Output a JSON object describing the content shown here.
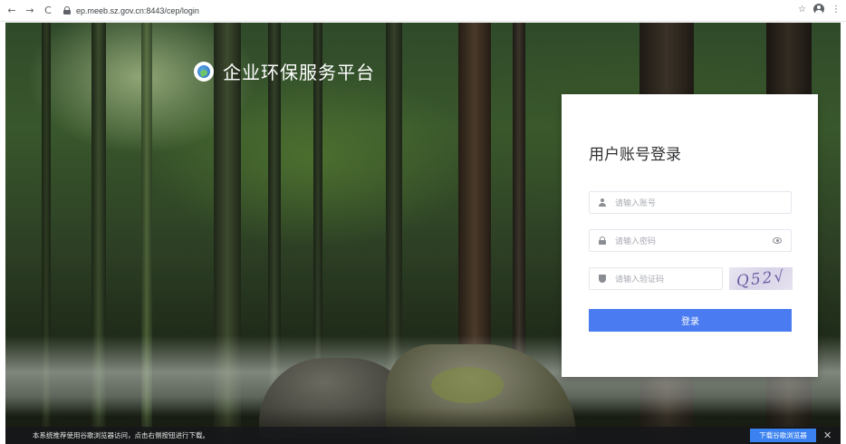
{
  "browser": {
    "back_glyph": "←",
    "forward_glyph": "→",
    "reload_glyph": "C",
    "url": "ep.meeb.sz.gov.cn:8443/cep/login",
    "icons": [
      "back-icon",
      "forward-icon",
      "reload-icon",
      "lock-icon",
      "star-icon",
      "profile-icon",
      "menu-icon"
    ],
    "star_glyph": "☆",
    "menu_glyph": "⋮"
  },
  "brand": {
    "title": "企业环保服务平台",
    "logo": "globe-leaf-logo"
  },
  "login": {
    "title": "用户账号登录",
    "account_placeholder": "请输入账号",
    "password_placeholder": "请输入密码",
    "captcha_placeholder": "请输入验证码",
    "captcha_text": "Q52√",
    "submit_label": "登录",
    "icons": [
      "user-icon",
      "lock-icon",
      "eye-icon",
      "shield-icon"
    ]
  },
  "notice": {
    "text": "本系统推荐使用谷歌浏览器访问，点击右侧按钮进行下载。",
    "download_label": "下载谷歌浏览器",
    "close_glyph": "✕"
  },
  "colors": {
    "primary": "#4a7bf0",
    "notice_bg": "#14161a",
    "card_bg": "#ffffff"
  }
}
